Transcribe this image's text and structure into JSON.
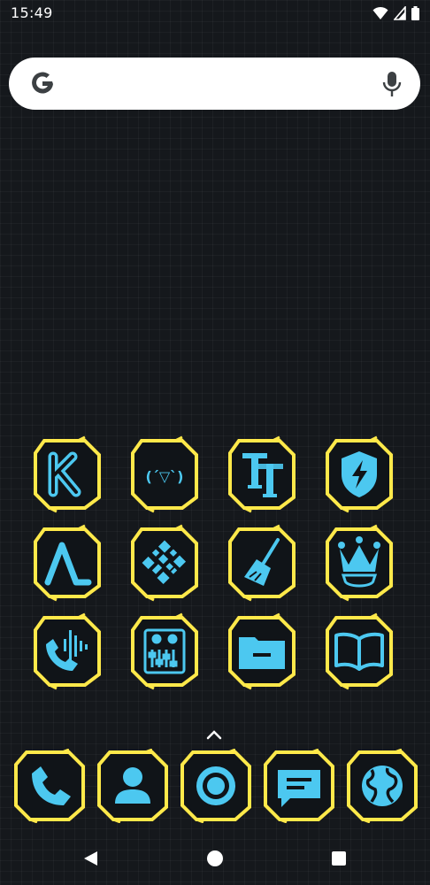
{
  "status_bar": {
    "time": "15:49",
    "icons": [
      "wifi-icon",
      "cellular-signal-icon",
      "battery-icon"
    ]
  },
  "search": {
    "logo": "google-g-icon",
    "mic": "mic-icon"
  },
  "colors": {
    "frame_yellow": "#ffe94a",
    "icon_cyan": "#4cc8f0",
    "background": "#15181c"
  },
  "home_icons": [
    {
      "row": 1,
      "icon": "k-letter-icon"
    },
    {
      "row": 1,
      "icon": "kaomoji-icon",
      "glyph_text": "(´▽`)"
    },
    {
      "row": 1,
      "icon": "font-tt-icon"
    },
    {
      "row": 1,
      "icon": "shield-bolt-icon"
    },
    {
      "row": 2,
      "icon": "zigzag-icon"
    },
    {
      "row": 2,
      "icon": "qr-pattern-icon"
    },
    {
      "row": 2,
      "icon": "broom-icon"
    },
    {
      "row": 2,
      "icon": "crown-icon"
    },
    {
      "row": 3,
      "icon": "phone-wave-icon"
    },
    {
      "row": 3,
      "icon": "equalizer-sliders-icon"
    },
    {
      "row": 3,
      "icon": "folder-icon"
    },
    {
      "row": 3,
      "icon": "open-book-icon"
    }
  ],
  "dock_icons": [
    "phone-icon",
    "contacts-icon",
    "camera-icon",
    "messages-icon",
    "browser-globe-icon"
  ],
  "nav": [
    "back-icon",
    "home-icon",
    "recents-icon"
  ]
}
